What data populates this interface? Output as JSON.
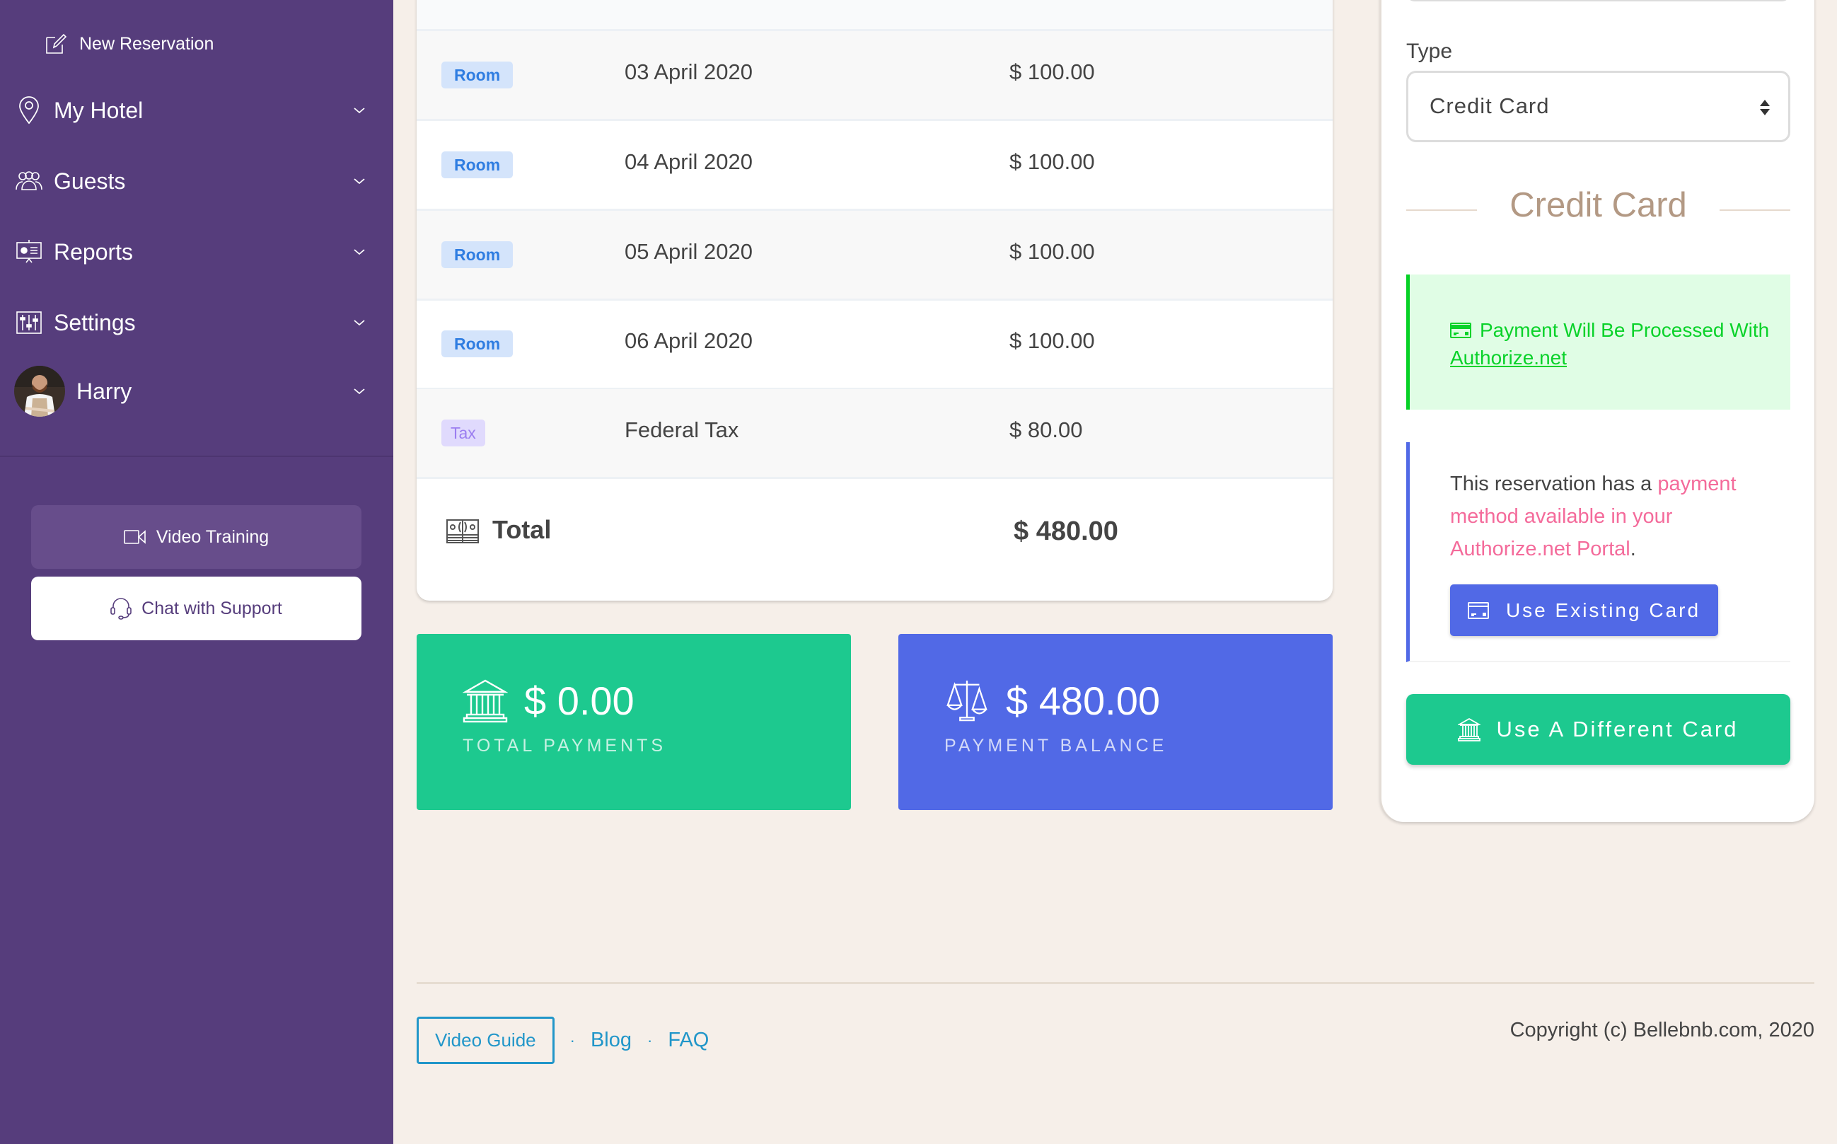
{
  "sidebar": {
    "new_reservation": {
      "label": "New Reservation",
      "icon": "edit-icon"
    },
    "items": [
      {
        "label": "My Hotel",
        "icon": "map-pin-icon"
      },
      {
        "label": "Guests",
        "icon": "users-icon"
      },
      {
        "label": "Reports",
        "icon": "presentation-icon"
      },
      {
        "label": "Settings",
        "icon": "sliders-icon"
      }
    ],
    "user": {
      "name": "Harry"
    },
    "buttons": {
      "video_training": "Video Training",
      "chat_support": "Chat with Support"
    }
  },
  "charges": {
    "rows": [
      {
        "type": "Room",
        "description": "03 April 2020",
        "amount": "$ 100.00"
      },
      {
        "type": "Room",
        "description": "04 April 2020",
        "amount": "$ 100.00"
      },
      {
        "type": "Room",
        "description": "05 April 2020",
        "amount": "$ 100.00"
      },
      {
        "type": "Room",
        "description": "06 April 2020",
        "amount": "$ 100.00"
      },
      {
        "type": "Tax",
        "description": "Federal Tax",
        "amount": "$ 80.00"
      }
    ],
    "total": {
      "label": "Total",
      "amount": "$ 480.00"
    }
  },
  "summary": {
    "total_payments": {
      "value": "$ 0.00",
      "label": "TOTAL PAYMENTS"
    },
    "payment_balance": {
      "value": "$ 480.00",
      "label": "PAYMENT BALANCE"
    }
  },
  "payment_form": {
    "type_label": "Type",
    "type_value": "Credit Card",
    "section_heading": "Credit Card",
    "processor_alert": {
      "text_before": "Payment Will Be Processed With ",
      "link": "Authorize.net"
    },
    "existing_method": {
      "text_before": "This reservation has a ",
      "highlight": "payment method available in your Authorize.net Portal",
      "text_after": "."
    },
    "use_existing_label": "Use Existing Card",
    "use_different_label": "Use A Different Card"
  },
  "footer": {
    "video_guide": "Video Guide",
    "separator": "·",
    "links": [
      "Blog",
      "FAQ"
    ],
    "copyright": "Copyright (c) Bellebnb.com, 2020"
  },
  "colors": {
    "sidebar": "#563d7c",
    "page_bg": "#f6efe9",
    "green": "#1dc98f",
    "blue": "#5169e6",
    "link": "#2196c9",
    "alert_green": "#06d126",
    "pink": "#f46b9b"
  }
}
